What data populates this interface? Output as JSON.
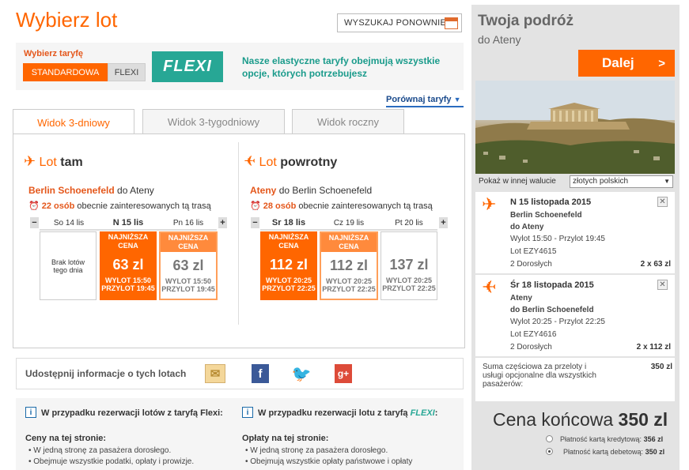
{
  "header": {
    "title": "Wybierz lot",
    "search_again": "WYSZUKAJ PONOWNIE"
  },
  "fare": {
    "label": "Wybierz taryfę",
    "options": [
      "STANDARDOWA",
      "FLEXI"
    ],
    "selected": "STANDARDOWA",
    "logo": "FLEXI",
    "description": "Nasze elastyczne taryfy obejmują wszystkie opcje, których potrzebujesz",
    "compare": "Porównaj taryfy"
  },
  "tabs": [
    "Widok 3-dniowy",
    "Widok 3-tygodniowy",
    "Widok roczny"
  ],
  "outbound": {
    "heading_pre": "Lot",
    "heading": "tam",
    "from": "Berlin Schoenefeld",
    "mid": "do",
    "to": "Ateny",
    "interest_count": "22 osób",
    "interest_text": "obecnie zainteresowanych tą trasą",
    "days": [
      {
        "label": "So 14 lis",
        "empty": "Brak lotów tego dnia"
      },
      {
        "label": "N 15 lis",
        "tag": "NAJNIŻSZA CENA",
        "price": "63 zl",
        "times": "WYLOT 15:50 PRZYLOT 19:45"
      },
      {
        "label": "Pn 16 lis",
        "tag": "NAJNIŻSZA CENA",
        "price": "63 zl",
        "times": "WYLOT 15:50 PRZYLOT 19:45"
      }
    ]
  },
  "return": {
    "heading_pre": "Lot",
    "heading": "powrotny",
    "from": "Ateny",
    "mid": "do",
    "to": "Berlin Schoenefeld",
    "interest_count": "28 osób",
    "interest_text": "obecnie zainteresowanych tą trasą",
    "days": [
      {
        "label": "Sr 18 lis",
        "tag": "NAJNIŻSZA CENA",
        "price": "112 zl",
        "times": "WYLOT 20:25 PRZYLOT 22:25"
      },
      {
        "label": "Cz 19 lis",
        "tag": "NAJNIŻSZA CENA",
        "price": "112 zl",
        "times": "WYLOT 20:25 PRZYLOT 22:25"
      },
      {
        "label": "Pt 20 lis",
        "price": "137 zl",
        "times": "WYLOT 20:25 PRZYLOT 22:25"
      }
    ]
  },
  "share": {
    "text": "Udostępnij informacje o tych lotach"
  },
  "info": {
    "left_title": "W przypadku rezerwacji lotów z taryfą Flexi:",
    "left_sub": "Ceny na tej stronie:",
    "left_items": [
      "W jedną stronę za pasażera dorosłego.",
      "Obejmuje wszystkie podatki, opłaty i prowizje."
    ],
    "right_title_pre": "W przypadku rezerwacji lotu z taryfą",
    "right_title_flexi": "FLEXI",
    "right_sub": "Opłaty na tej stronie:",
    "right_items": [
      "W jedną stronę za pasażera dorosłego.",
      "Obejmują wszystkie opłaty państwowe i opłaty"
    ]
  },
  "sidebar": {
    "title": "Twoja podróż",
    "dest": "do Ateny",
    "next": "Dalej",
    "currency_label": "Pokaż w innej walucie",
    "currency": "złotych polskich",
    "segments": [
      {
        "date": "N 15 listopada 2015",
        "from": "Berlin Schoenefeld",
        "to": "do Ateny",
        "times": "Wylot 15:50 - Przylot 19:45",
        "flight": "Lot EZY4615",
        "pax": "2 Dorosłych",
        "amount": "2 x 63 zl"
      },
      {
        "date": "Śr 18 listopada 2015",
        "from": "Ateny",
        "to": "do Berlin Schoenefeld",
        "times": "Wylot 20:25 - Przylot 22:25",
        "flight": "Lot EZY4616",
        "pax": "2 Dorosłych",
        "amount": "2 x 112 zl"
      }
    ],
    "subtotal_label": "Suma częściowa za przeloty i usługi opcjonalne dla wszystkich pasażerów:",
    "subtotal": "350 zl",
    "final_label": "Cena końcowa",
    "final_value": "350 zl",
    "payments": [
      {
        "label": "Płatność kartą kredytową:",
        "value": "356 zl",
        "selected": false
      },
      {
        "label": "Płatność kartą debetową:",
        "value": "350 zl",
        "selected": true
      }
    ]
  },
  "colors": {
    "accent": "#ff6600",
    "teal": "#27a795",
    "link": "#1a4a8c"
  }
}
